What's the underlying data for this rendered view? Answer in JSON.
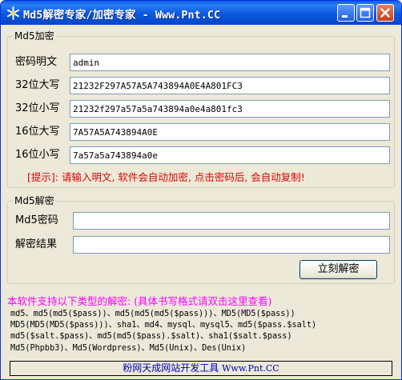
{
  "window": {
    "title": "Md5解密专家/加密专家 - Www.Pnt.CC",
    "titlebar_color": "#0b58de"
  },
  "encrypt": {
    "legend": "Md5加密",
    "fields": [
      {
        "label": "密码明文",
        "value": "admin"
      },
      {
        "label": "32位大写",
        "value": "21232F297A57A5A743894A0E4A801FC3"
      },
      {
        "label": "32位小写",
        "value": "21232f297a57a5a743894a0e4a801fc3"
      },
      {
        "label": "16位大写",
        "value": "7A57A5A743894A0E"
      },
      {
        "label": "16位小写",
        "value": "7a57a5a743894a0e"
      }
    ],
    "hint": "[提示]: 请输入明文, 软件会自动加密, 点击密码后, 会自动复制!",
    "hint_color": "#e00000"
  },
  "decrypt": {
    "legend": "Md5解密",
    "hash_label": "Md5密码",
    "hash_value": "",
    "result_label": "解密结果",
    "result_value": "",
    "button_label": "立刻解密"
  },
  "support": {
    "text": "本软件支持以下类型的解密: (具体书写格式请双击这里查看)",
    "color": "#ff00ff",
    "lines": [
      "md5、md5(md5($pass))、md5(md5(md5($pass)))、MD5(MD5($pass))",
      "MD5(MD5(MD5($pass)))、sha1、md4、mysql、mysql5、md5($pass.$salt)",
      "md5($salt.$pass)、md5(md5($pass).$salt)、sha1($salt.$pass)",
      "Md5(Phpbb3)、Md5(Wordpress)、Md5(Unix)、Des(Unix)"
    ]
  },
  "footer": {
    "text": "粉网天成网站开发工具",
    "url": "Www.Pnt.CC",
    "color": "#0000c0"
  }
}
